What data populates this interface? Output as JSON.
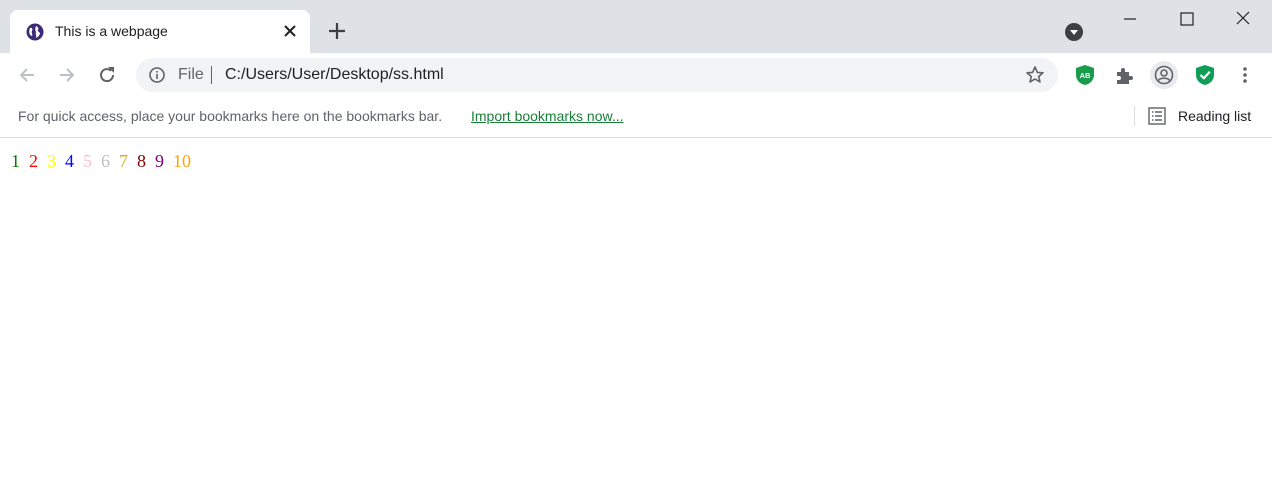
{
  "browser": {
    "tab": {
      "title": "This is a webpage",
      "favicon": "globe-icon"
    },
    "address_bar": {
      "scheme_label": "File",
      "url": "C:/Users/User/Desktop/ss.html"
    },
    "bookmarks_bar": {
      "prompt": "For quick access, place your bookmarks here on the bookmarks bar.",
      "import_link": "Import bookmarks now...",
      "reading_list_label": "Reading list"
    },
    "extensions": [
      "adblock-icon",
      "puzzle-icon",
      "profile-icon",
      "shield-check-icon"
    ],
    "colors": {
      "titlebar": "#dee1e6",
      "omnibox": "#f1f3f4",
      "link": "#188038",
      "favicon": "#3c2a78"
    }
  },
  "page": {
    "numbers": [
      {
        "text": "1",
        "color": "#008000"
      },
      {
        "text": "2",
        "color": "#ff0000"
      },
      {
        "text": "3",
        "color": "#ffff00"
      },
      {
        "text": "4",
        "color": "#0000ff"
      },
      {
        "text": "5",
        "color": "#ffc0cb"
      },
      {
        "text": "6",
        "color": "#c0c0c0"
      },
      {
        "text": "7",
        "color": "#d4b020"
      },
      {
        "text": "8",
        "color": "#800000"
      },
      {
        "text": "9",
        "color": "#800080"
      },
      {
        "text": "10",
        "color": "#ffa500"
      }
    ]
  }
}
